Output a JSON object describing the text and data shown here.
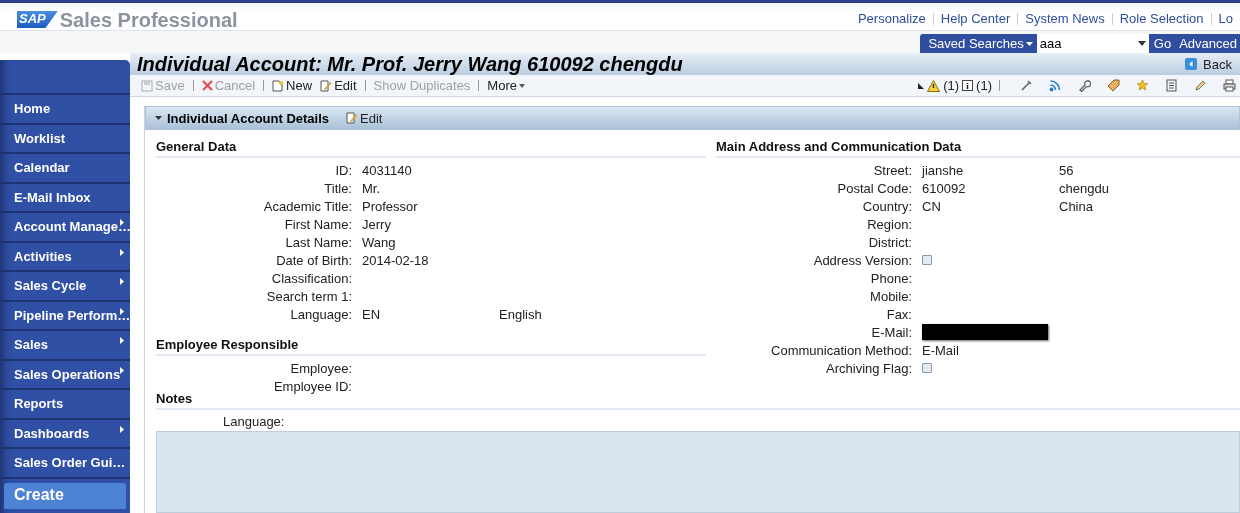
{
  "header": {
    "logo": "SAP",
    "app_title": "Sales Professional",
    "links": [
      "Personalize",
      "Help Center",
      "System News",
      "Role Selection",
      "Lo"
    ]
  },
  "search": {
    "saved_searches": "Saved Searches",
    "value": "aaa",
    "go": "Go",
    "advanced": "Advanced"
  },
  "nav": {
    "items": [
      {
        "label": "Home",
        "submenu": false
      },
      {
        "label": "Worklist",
        "submenu": false
      },
      {
        "label": "Calendar",
        "submenu": false
      },
      {
        "label": "E-Mail Inbox",
        "submenu": false
      },
      {
        "label": "Account Manage…",
        "submenu": true
      },
      {
        "label": "Activities",
        "submenu": true
      },
      {
        "label": "Sales Cycle",
        "submenu": true
      },
      {
        "label": "Pipeline Perform…",
        "submenu": true
      },
      {
        "label": "Sales",
        "submenu": true
      },
      {
        "label": "Sales Operations",
        "submenu": true
      },
      {
        "label": "Reports",
        "submenu": false
      },
      {
        "label": "Dashboards",
        "submenu": true
      },
      {
        "label": "Sales Order Gui…",
        "submenu": false
      }
    ],
    "create": "Create"
  },
  "page": {
    "title": "Individual Account: Mr. Prof. Jerry Wang 610092 chengdu",
    "back": "Back",
    "toolbar": [
      {
        "kind": "save",
        "label": "Save",
        "disabled": true
      },
      {
        "kind": "cancel",
        "label": "Cancel",
        "disabled": true
      },
      {
        "kind": "new",
        "label": "New",
        "disabled": false
      },
      {
        "kind": "edit",
        "label": "Edit",
        "disabled": false
      },
      {
        "kind": "plain",
        "label": "Show Duplicates",
        "disabled": true
      },
      {
        "kind": "more",
        "label": "More",
        "disabled": false
      }
    ],
    "warning_count": "(1)",
    "info_count": "(1)"
  },
  "details": {
    "title": "Individual Account Details",
    "edit": "Edit",
    "general": {
      "title": "General Data",
      "fields": [
        {
          "label": "ID:",
          "value": "4031140"
        },
        {
          "label": "Title:",
          "value": "Mr."
        },
        {
          "label": "Academic Title:",
          "value": "Professor"
        },
        {
          "label": "First Name:",
          "value": "Jerry"
        },
        {
          "label": "Last Name:",
          "value": "Wang"
        },
        {
          "label": "Date of Birth:",
          "value": "2014-02-18"
        },
        {
          "label": "Classification:"
        },
        {
          "label": "Search term 1:"
        },
        {
          "label": "Language:",
          "value": "EN",
          "extra": "English"
        }
      ]
    },
    "employee": {
      "title": "Employee Responsible",
      "fields": [
        {
          "label": "Employee:"
        },
        {
          "label": "Employee ID:"
        }
      ]
    },
    "address": {
      "title": "Main Address and Communication Data",
      "fields": [
        {
          "label": "Street:",
          "value": "jianshe",
          "number": "56",
          "kind": "text"
        },
        {
          "label": "Postal Code:",
          "value": "610092",
          "extra": "chengdu",
          "kind": "text"
        },
        {
          "label": "Country:",
          "value": "CN",
          "extra": "China",
          "kind": "text"
        },
        {
          "label": "Region:",
          "kind": "text"
        },
        {
          "label": "District:",
          "kind": "text"
        },
        {
          "label": "Address Version:",
          "kind": "checkbox",
          "checked": false
        },
        {
          "label": "Phone:",
          "kind": "text"
        },
        {
          "label": "Mobile:",
          "kind": "text"
        },
        {
          "label": "Fax:",
          "kind": "text"
        },
        {
          "label": "E-Mail:",
          "kind": "redacted"
        },
        {
          "label": "Communication Method:",
          "value": "E-Mail",
          "kind": "text"
        },
        {
          "label": "Archiving Flag:",
          "kind": "checkbox",
          "checked": false
        }
      ]
    },
    "notes": {
      "title": "Notes",
      "language_label": "Language:"
    }
  }
}
